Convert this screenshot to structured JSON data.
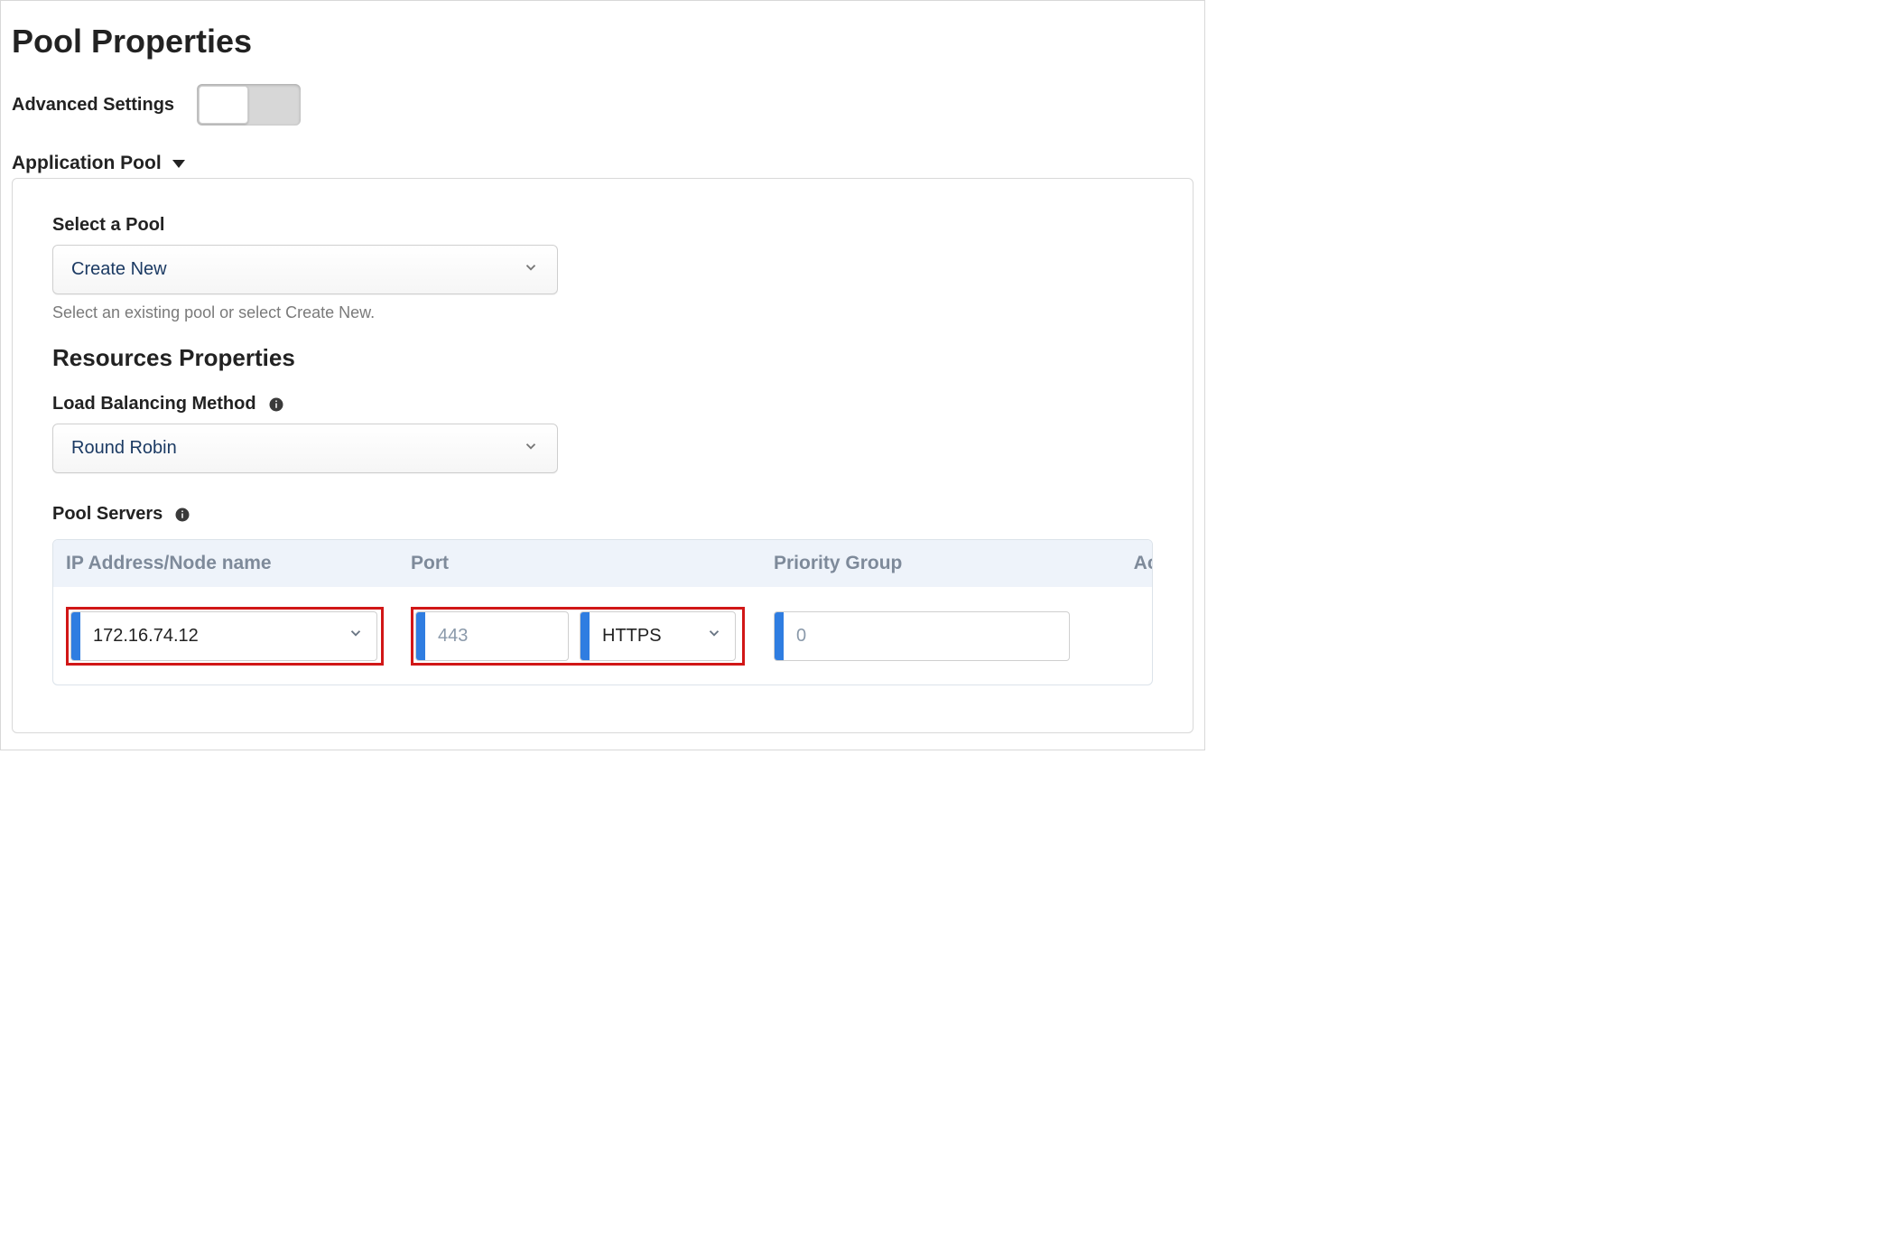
{
  "page": {
    "title": "Pool Properties"
  },
  "advanced": {
    "label": "Advanced Settings",
    "enabled": false
  },
  "section": {
    "title": "Application Pool"
  },
  "pool_select": {
    "label": "Select a Pool",
    "value": "Create New",
    "helper": "Select an existing pool or select Create New."
  },
  "resources": {
    "title": "Resources Properties"
  },
  "lb_method": {
    "label": "Load Balancing Method",
    "value": "Round Robin"
  },
  "servers": {
    "label": "Pool Servers",
    "columns": {
      "ip": "IP Address/Node name",
      "port": "Port",
      "priority": "Priority Group",
      "action": "Action"
    },
    "rows": [
      {
        "ip": "172.16.74.12",
        "port": "443",
        "protocol": "HTTPS",
        "priority": "0"
      }
    ]
  },
  "icons": {
    "plus": "+",
    "close": "✕"
  }
}
